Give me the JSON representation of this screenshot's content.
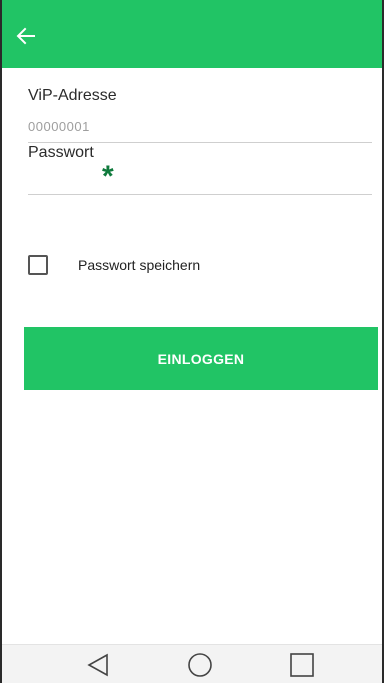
{
  "app_bar": {
    "back_icon": "arrow-left-icon",
    "color": "#21c465"
  },
  "form": {
    "vip_label": "ViP-Adresse",
    "vip_value": "00000001",
    "password_label": "Passwort",
    "password_mask": "*",
    "password_mask_color": "#0f7a3c"
  },
  "remember": {
    "label": "Passwort speichern",
    "checked": false
  },
  "login_button": {
    "label": "EINLOGGEN",
    "color": "#21c465"
  },
  "nav_bar": {
    "back_icon": "triangle-back-icon",
    "home_icon": "circle-home-icon",
    "recents_icon": "square-recents-icon"
  }
}
